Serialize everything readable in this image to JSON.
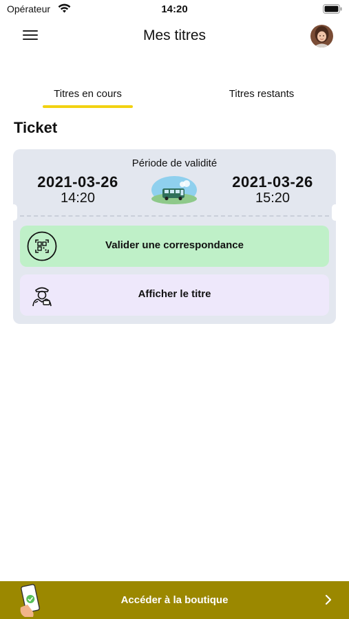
{
  "status_bar": {
    "carrier": "Opérateur",
    "time": "14:20",
    "wifi_icon": "wifi-icon",
    "battery_icon": "battery-icon"
  },
  "nav": {
    "title": "Mes titres",
    "menu_icon": "menu-icon",
    "avatar": "user-avatar"
  },
  "tabs": [
    {
      "label": "Titres en cours",
      "active": true
    },
    {
      "label": "Titres restants",
      "active": false
    }
  ],
  "section_title": "Ticket",
  "ticket": {
    "validity_label": "Période de validité",
    "start_date": "2021-03-26",
    "start_time": "14:20",
    "end_date": "2021-03-26",
    "end_time": "15:20",
    "illustration": "bus-icon"
  },
  "actions": {
    "validate_label": "Valider une correspondance",
    "validate_icon": "qr-code-icon",
    "show_label": "Afficher le titre",
    "show_icon": "controller-icon"
  },
  "shop": {
    "label": "Accéder à la boutique",
    "icon": "phone-ticket-icon",
    "chevron": "chevron-right-icon"
  },
  "colors": {
    "accent_yellow": "#f2d211",
    "card_background": "#e3e7ef",
    "validate_background": "#bff0c8",
    "show_background": "#eee8fb",
    "shop_bar": "#9b8800"
  }
}
